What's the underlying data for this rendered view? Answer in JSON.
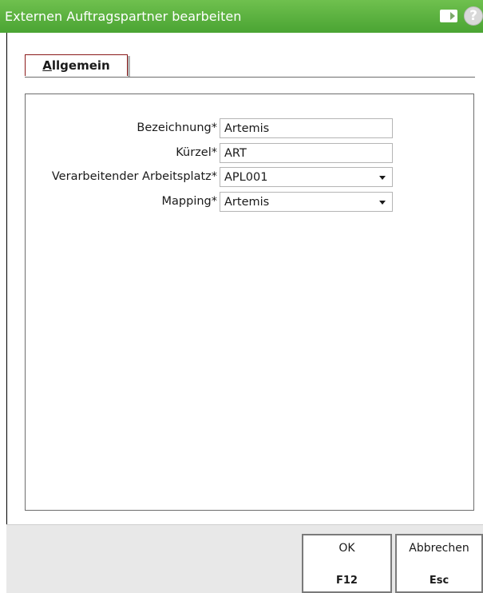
{
  "window": {
    "title": "Externen Auftragspartner bearbeiten"
  },
  "tabs": [
    {
      "accel": "A",
      "rest": "llgemein",
      "label": "Allgemein",
      "selected": true
    }
  ],
  "form": {
    "bezeichnung": {
      "label": "Bezeichnung*",
      "value": "Artemis"
    },
    "kuerzel": {
      "label": "Kürzel*",
      "value": "ART"
    },
    "arbeitsplatz": {
      "label": "Verarbeitender Arbeitsplatz*",
      "value": "APL001"
    },
    "mapping": {
      "label": "Mapping*",
      "value": "Artemis"
    }
  },
  "buttons": {
    "ok": {
      "label": "OK",
      "key": "F12"
    },
    "cancel": {
      "label": "Abbrechen",
      "key": "Esc"
    }
  },
  "colors": {
    "titlebar": "#5cb33f",
    "tab_border": "#8b1a1a"
  }
}
